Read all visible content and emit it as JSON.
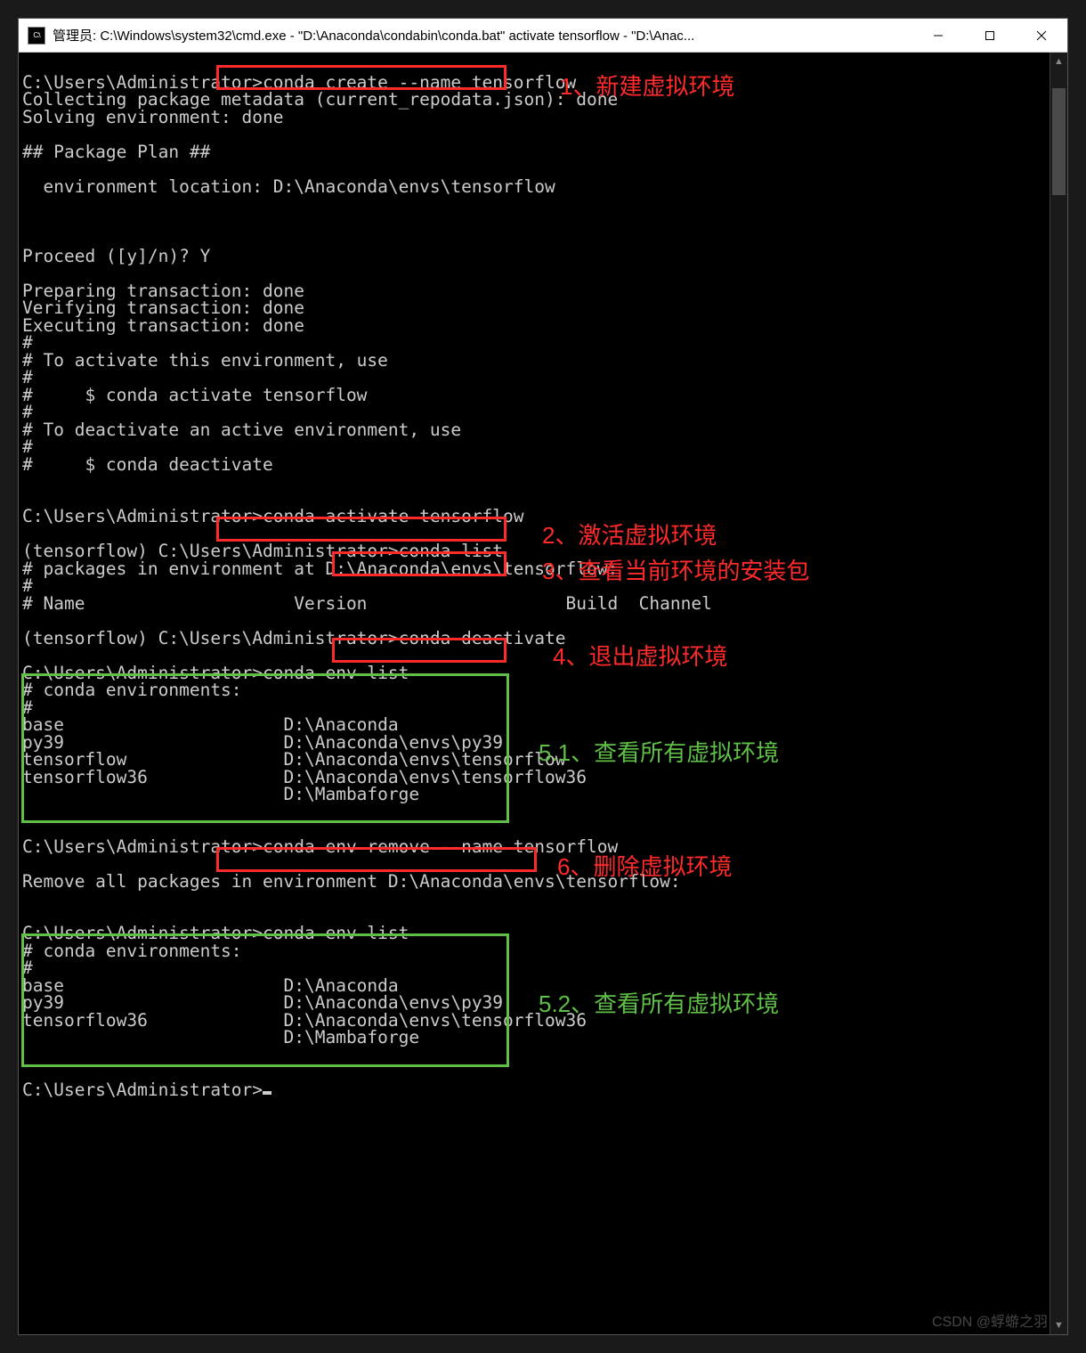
{
  "window": {
    "title": "管理员: C:\\Windows\\system32\\cmd.exe - \"D:\\Anaconda\\condabin\\conda.bat\"  activate tensorflow - \"D:\\Anac...",
    "icon_label": "C:\\"
  },
  "terminal_lines": [
    "",
    "C:\\Users\\Administrator>conda create --name tensorflow",
    "Collecting package metadata (current_repodata.json): done",
    "Solving environment: done",
    "",
    "## Package Plan ##",
    "",
    "  environment location: D:\\Anaconda\\envs\\tensorflow",
    "",
    "",
    "",
    "Proceed ([y]/n)? Y",
    "",
    "Preparing transaction: done",
    "Verifying transaction: done",
    "Executing transaction: done",
    "#",
    "# To activate this environment, use",
    "#",
    "#     $ conda activate tensorflow",
    "#",
    "# To deactivate an active environment, use",
    "#",
    "#     $ conda deactivate",
    "",
    "",
    "C:\\Users\\Administrator>conda activate tensorflow",
    "",
    "(tensorflow) C:\\Users\\Administrator>conda list",
    "# packages in environment at D:\\Anaconda\\envs\\tensorflow:",
    "#",
    "# Name                    Version                   Build  Channel",
    "",
    "(tensorflow) C:\\Users\\Administrator>conda deactivate",
    "",
    "C:\\Users\\Administrator>conda env list",
    "# conda environments:",
    "#",
    "base                     D:\\Anaconda",
    "py39                     D:\\Anaconda\\envs\\py39",
    "tensorflow               D:\\Anaconda\\envs\\tensorflow",
    "tensorflow36             D:\\Anaconda\\envs\\tensorflow36",
    "                         D:\\Mambaforge",
    "",
    "",
    "C:\\Users\\Administrator>conda env remove --name tensorflow",
    "",
    "Remove all packages in environment D:\\Anaconda\\envs\\tensorflow:",
    "",
    "",
    "C:\\Users\\Administrator>conda env list",
    "# conda environments:",
    "#",
    "base                     D:\\Anaconda",
    "py39                     D:\\Anaconda\\envs\\py39",
    "tensorflow36             D:\\Anaconda\\envs\\tensorflow36",
    "                         D:\\Mambaforge",
    "",
    "",
    "C:\\Users\\Administrator>"
  ],
  "annotations": {
    "a1": "1、新建虚拟环境",
    "a2": "2、激活虚拟环境",
    "a3": "3、查看当前环境的安装包",
    "a4": "4、退出虚拟环境",
    "a51": "5.1、查看所有虚拟环境",
    "a6": "6、删除虚拟环境",
    "a52": "5.2、查看所有虚拟环境"
  },
  "watermark": "CSDN @蜉蝣之羽"
}
